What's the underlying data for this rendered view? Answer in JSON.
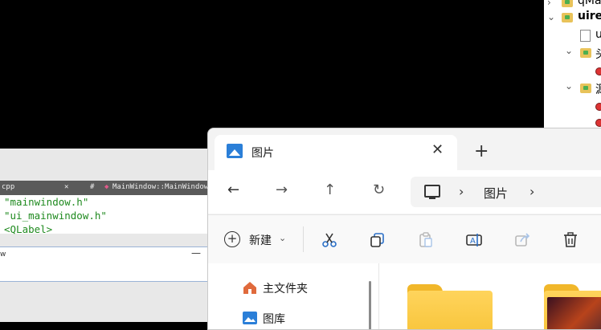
{
  "project_tree": {
    "rows": [
      {
        "label": "qMa",
        "expanded": false
      },
      {
        "label": "uire",
        "expanded": true
      },
      {
        "label": "u"
      },
      {
        "label": "头",
        "expanded": true
      },
      {
        "label": ""
      },
      {
        "label": "源",
        "expanded": true
      },
      {
        "label": ""
      },
      {
        "label": ""
      }
    ]
  },
  "editor": {
    "tabs": {
      "file_tab": "cpp",
      "close_x": "✕",
      "hash": "#",
      "symbol": "MainWindow::MainWindow"
    },
    "code_lines": [
      "\"mainwindow.h\"",
      "\"ui_mainwindow.h\"",
      "<QLabel>"
    ],
    "lower_pane_char": "w"
  },
  "explorer": {
    "tab_title": "图片",
    "address": {
      "crumb": "图片"
    },
    "toolbar": {
      "new_label": "新建"
    },
    "sidebar": [
      {
        "label": "主文件夹",
        "icon": "home-icon"
      },
      {
        "label": "图库",
        "icon": "gallery-icon"
      }
    ]
  }
}
